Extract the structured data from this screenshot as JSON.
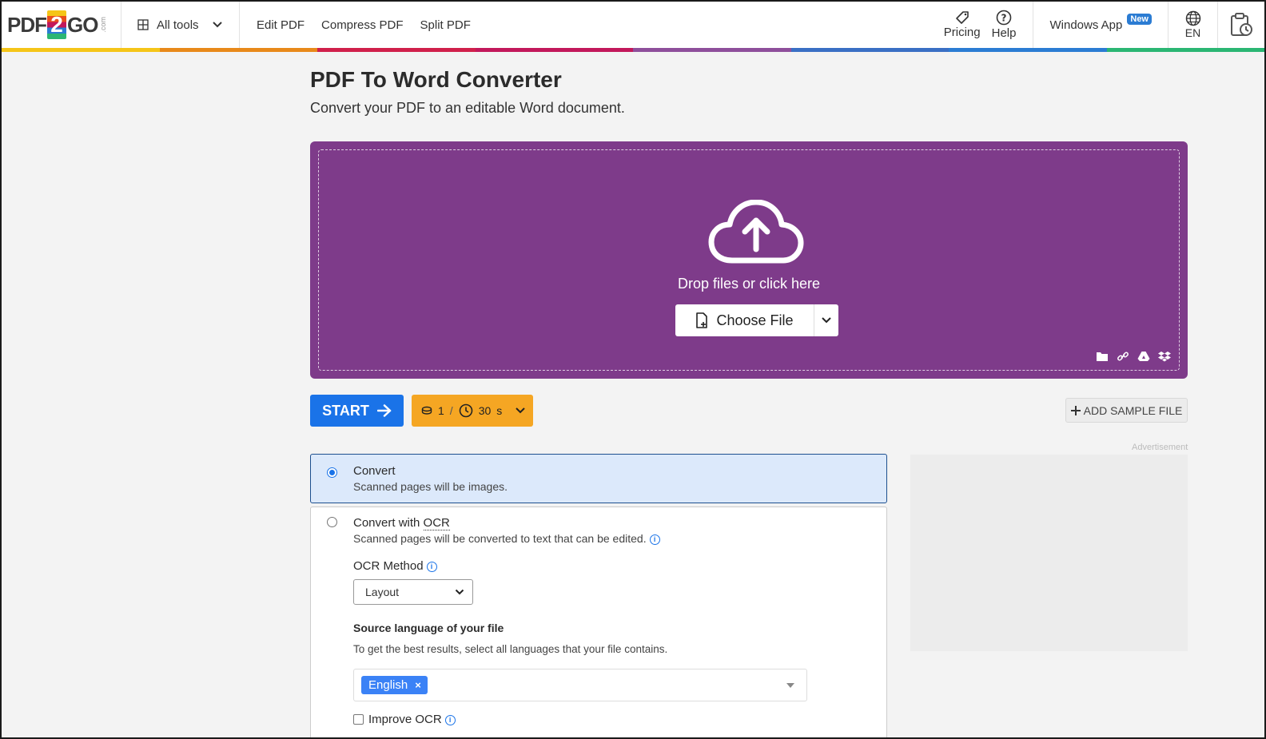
{
  "header": {
    "logo": {
      "left": "PDF",
      "digit": "2",
      "right": "GO",
      "suffix": ".com"
    },
    "all_tools": "All tools",
    "nav": [
      "Edit PDF",
      "Compress PDF",
      "Split PDF"
    ],
    "pricing": "Pricing",
    "help": "Help",
    "windows_app": "Windows App",
    "new_badge": "New",
    "language": "EN"
  },
  "colorbar": [
    "#f5c518",
    "#e8891a",
    "#d0204b",
    "#c2185b",
    "#8e4f9b",
    "#3a6fc4",
    "#2b7cd3",
    "#2bb673"
  ],
  "page": {
    "title": "PDF To Word Converter",
    "subtitle": "Convert your PDF to an editable Word document."
  },
  "dropzone": {
    "text": "Drop files or click here",
    "choose_file": "Choose File",
    "source_icons": [
      "folder-icon",
      "link-icon",
      "google-drive-icon",
      "dropbox-icon"
    ],
    "accent": "#7e3b8a"
  },
  "actions": {
    "start": "START",
    "credits": "1",
    "credits_sep": "/",
    "time": "30",
    "time_unit": "s",
    "add_sample": "ADD SAMPLE FILE"
  },
  "ad": {
    "label": "Advertisement"
  },
  "options": {
    "convert": {
      "title": "Convert",
      "desc": "Scanned pages will be images.",
      "selected": true
    },
    "convert_ocr": {
      "title_prefix": "Convert with ",
      "title_abbr": "OCR",
      "desc": "Scanned pages will be converted to text that can be edited.",
      "selected": false,
      "ocr_method_label": "OCR Method",
      "ocr_method_value": "Layout",
      "source_lang_label": "Source language of your file",
      "source_lang_help": "To get the best results, select all languages that your file contains.",
      "languages": [
        "English"
      ],
      "improve_ocr": "Improve OCR"
    }
  }
}
